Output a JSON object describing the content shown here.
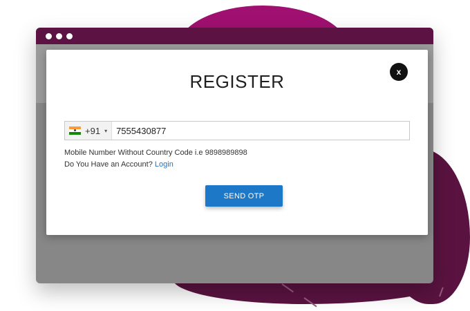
{
  "modal": {
    "title": "REGISTER",
    "close_label": "x"
  },
  "phone": {
    "country_flag": "india-flag-icon",
    "dial_code": "+91",
    "caret": "▾",
    "value": "7555430877"
  },
  "hint": "Mobile Number Without Country Code i.e 9898989898",
  "account": {
    "prompt": "Do You Have an Account?",
    "login_label": "Login"
  },
  "actions": {
    "send_otp_label": "SEND OTP"
  },
  "colors": {
    "window_bar": "#5c1242",
    "accent_blob": "#a01070",
    "dark_blob": "#5a1340",
    "button": "#1e78c8",
    "link": "#1e72c4"
  }
}
